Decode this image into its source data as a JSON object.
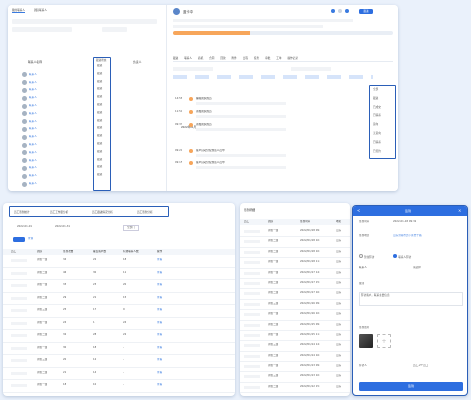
{
  "crm": {
    "tabs": [
      "我的联系人",
      "团队联系人"
    ],
    "columns": {
      "name": "联系人名称",
      "status": "跟进状态",
      "last": "最后跟进",
      "owner": "负责人"
    },
    "status_values": [
      "跟进",
      "跟进",
      "跟进",
      "跟进",
      "跟进",
      "跟进",
      "跟进",
      "跟进",
      "跟进",
      "跟进",
      "跟进",
      "跟进",
      "跟进",
      "跟进",
      "跟进"
    ],
    "contacts": [
      "联系人",
      "联系人",
      "联系人",
      "联系人",
      "联系人",
      "联系人",
      "联系人",
      "联系人",
      "联系人",
      "联系人",
      "联系人",
      "联系人",
      "联系人",
      "联系人",
      "联系人"
    ],
    "detail": {
      "name": "蓝卡中",
      "action_btn": "跟进",
      "tabs": [
        "跟进",
        "联系人",
        "商机",
        "合同",
        "回款",
        "附件",
        "日程",
        "任务",
        "审批",
        "工单",
        "操作记录"
      ],
      "timeline_header": "2022年01月",
      "events": [
        {
          "time": "14:58",
          "title": "编辑团队成员"
        },
        {
          "time": "11:50",
          "title": "添加团队成员"
        },
        {
          "time": "09:33",
          "title": "添加团队成员"
        },
        {
          "time": "09:20",
          "title": "客户自动分配到该人员中"
        },
        {
          "time": "09:15",
          "title": "客户自动分配到该人员中"
        }
      ]
    },
    "dropdown": [
      "全部",
      "跟进",
      "已成交",
      "已联系",
      "意向",
      "无意向",
      "已联系",
      "已签约"
    ]
  },
  "stats": {
    "tabs": [
      "员工签到统计",
      "员工工作量分析",
      "员工跟进情况分析",
      "员工签到分析"
    ],
    "date_from": "2022-01-01",
    "date_to": "2022-01-31",
    "filter_label": "全部门",
    "query_btn": "查询",
    "columns": [
      "员工",
      "团队",
      "签到次数",
      "覆盖客户数",
      "有效联系人数",
      "操作"
    ],
    "rows": [
      {
        "team": "销售一组",
        "a": "34",
        "b": "22",
        "c": "18",
        "op": "查看"
      },
      {
        "team": "销售二组",
        "a": "46",
        "b": "30",
        "c": "11",
        "op": "查看"
      },
      {
        "team": "销售一组",
        "a": "33",
        "b": "23",
        "c": "20",
        "op": "查看"
      },
      {
        "team": "销售二组",
        "a": "29",
        "b": "21",
        "c": "15",
        "op": "查看"
      },
      {
        "team": "销售三组",
        "a": "25",
        "b": "17",
        "c": "9",
        "op": "查看"
      },
      {
        "team": "销售一组",
        "a": "24",
        "b": "1",
        "c": "24",
        "op": "查看"
      },
      {
        "team": "销售二组",
        "a": "32",
        "b": "28",
        "c": "22",
        "op": "查看"
      },
      {
        "team": "销售一组",
        "a": "30",
        "b": "18",
        "c": "-",
        "op": "查看"
      },
      {
        "team": "销售三组",
        "a": "20",
        "b": "12",
        "c": "-",
        "op": "查看"
      },
      {
        "team": "销售二组",
        "a": "21",
        "b": "14",
        "c": "-",
        "op": "查看"
      },
      {
        "team": "销售一组",
        "a": "18",
        "b": "10",
        "c": "-",
        "op": "查看"
      }
    ]
  },
  "checkin_log": {
    "title": "签到明细",
    "columns": [
      "员工",
      "团队",
      "签到时间",
      "地址"
    ],
    "rows": [
      {
        "team": "销售一组",
        "time": "2022/01/18 09:",
        "addr": "山东"
      },
      {
        "team": "销售二组",
        "time": "2022/01/18 10:",
        "addr": "山东"
      },
      {
        "team": "销售二组",
        "time": "2022/01/18 10:",
        "addr": "山东"
      },
      {
        "team": "销售一组",
        "time": "2022/01/18 11:",
        "addr": "山东"
      },
      {
        "team": "销售一组",
        "time": "2022/01/17 14:",
        "addr": "山东"
      },
      {
        "team": "销售二组",
        "time": "2022/01/17 15:",
        "addr": "山东"
      },
      {
        "team": "销售二组",
        "time": "2022/01/17 16:",
        "addr": "山东"
      },
      {
        "team": "销售三组",
        "time": "2022/01/16 09:",
        "addr": "山东"
      },
      {
        "team": "销售一组",
        "time": "2022/01/16 10:",
        "addr": "山东"
      },
      {
        "team": "销售二组",
        "time": "2022/01/15 09:",
        "addr": "山东"
      },
      {
        "team": "销售一组",
        "time": "2022/01/15 11:",
        "addr": "山东"
      },
      {
        "team": "销售三组",
        "time": "2022/01/14 14:",
        "addr": "山东"
      },
      {
        "team": "销售二组",
        "time": "2022/01/14 16:",
        "addr": "山东"
      },
      {
        "team": "销售一组",
        "time": "2022/01/13 09:",
        "addr": "山东"
      },
      {
        "team": "销售三组",
        "time": "2022/01/13 10:",
        "addr": "山东"
      },
      {
        "team": "销售二组",
        "time": "2022/01/12 15:",
        "addr": "山东"
      }
    ]
  },
  "mobile": {
    "back": "<",
    "title": "签到",
    "close": "×",
    "fields": [
      {
        "label": "签到时间",
        "value": "2022-01-18 09:32"
      },
      {
        "label": "签到地点",
        "value": "山东济南市历下区经十路"
      }
    ],
    "opt_checkin": "暂住拜访",
    "opt_contact": "联系人拜访",
    "contact_label": "联系人",
    "contact_value": "请选择",
    "note_label": "备注",
    "note_value": "拜访客户，联系主要信息",
    "photo_label": "签到照片",
    "person_label": "拜访人",
    "person_value": "员工,2个员工",
    "submit": "签到"
  }
}
